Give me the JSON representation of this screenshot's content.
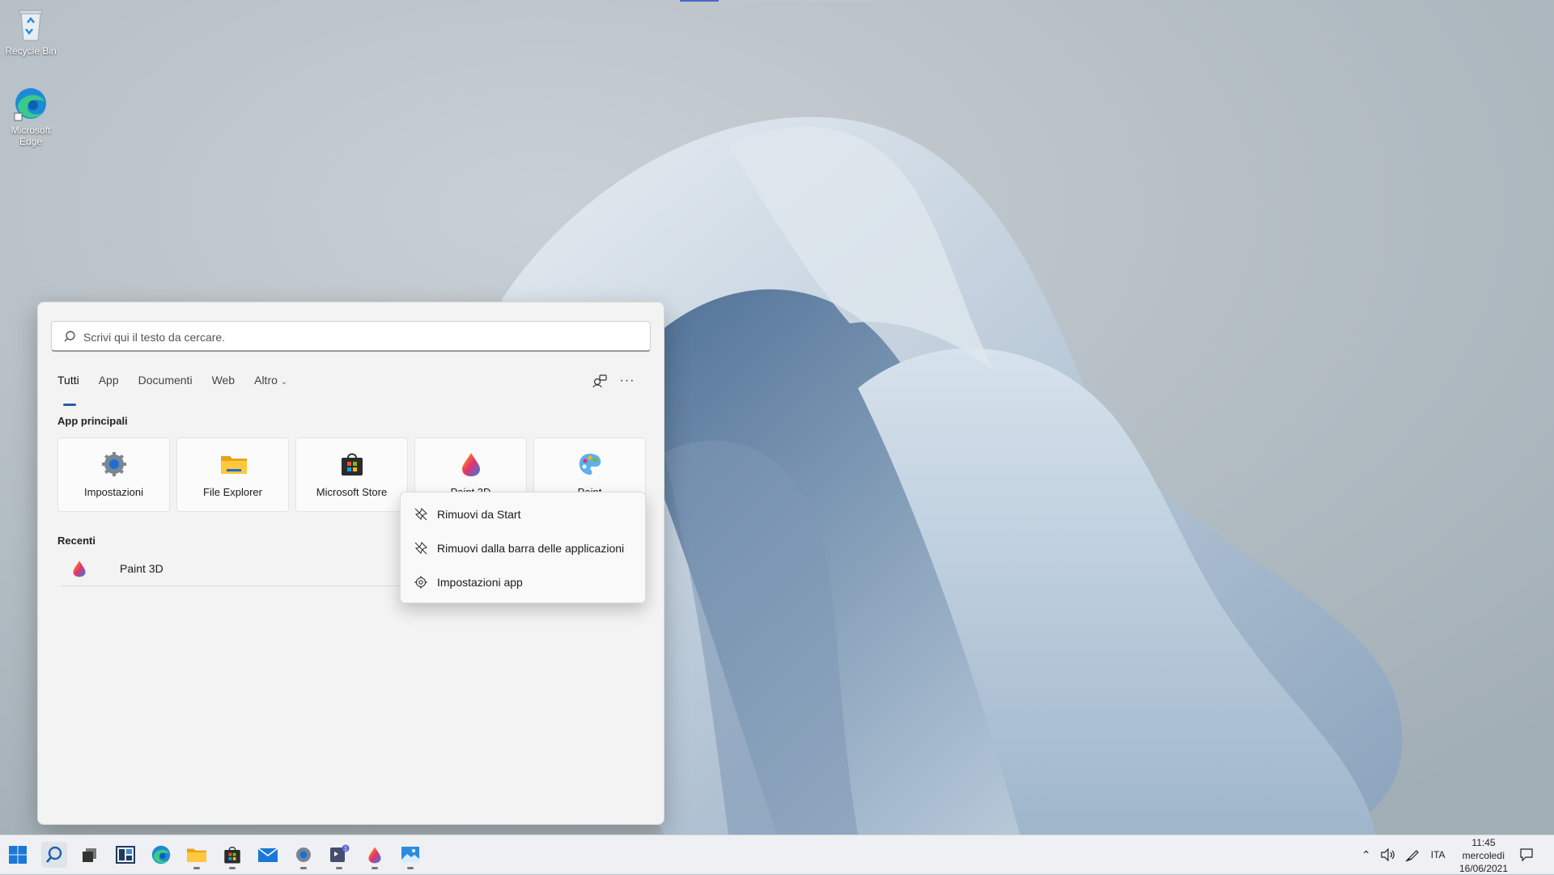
{
  "desktop": {
    "icons": [
      {
        "label": "Recycle Bin",
        "icon": "recycle-bin-icon"
      },
      {
        "label": "Microsoft Edge",
        "icon": "edge-icon"
      }
    ]
  },
  "search_panel": {
    "placeholder": "Scrivi qui il testo da cercare.",
    "tabs": [
      {
        "label": "Tutti",
        "active": true
      },
      {
        "label": "App"
      },
      {
        "label": "Documenti"
      },
      {
        "label": "Web"
      },
      {
        "label": "Altro",
        "has_dropdown": true
      }
    ],
    "top_apps_title": "App principali",
    "top_apps": [
      {
        "label": "Impostazioni",
        "icon": "settings-gear-icon"
      },
      {
        "label": "File Explorer",
        "icon": "folder-icon"
      },
      {
        "label": "Microsoft Store",
        "icon": "store-bag-icon"
      },
      {
        "label": "Paint 3D",
        "icon": "paint3d-drop-icon"
      },
      {
        "label": "Paint",
        "icon": "paint-palette-icon"
      }
    ],
    "recent_title": "Recenti",
    "recent": [
      {
        "label": "Paint 3D",
        "icon": "paint3d-drop-icon"
      }
    ]
  },
  "context_menu": {
    "items": [
      {
        "label": "Rimuovi da Start",
        "icon": "unpin-icon"
      },
      {
        "label": "Rimuovi dalla barra delle applicazioni",
        "icon": "unpin-icon"
      },
      {
        "label": "Impostazioni app",
        "icon": "gear-icon"
      }
    ]
  },
  "taskbar": {
    "apps": [
      "start-icon",
      "search-icon",
      "task-view-icon",
      "widgets-icon",
      "edge-icon",
      "file-explorer-icon",
      "store-icon",
      "mail-icon",
      "settings-icon",
      "teams-icon",
      "paint3d-icon",
      "photos-icon"
    ],
    "tray": {
      "language": "ITA",
      "time": "11:45",
      "day": "mercoledì",
      "date": "16/06/2021"
    }
  },
  "colors": {
    "accent": "#2a5ba8",
    "panel_bg": "#f3f3f3",
    "taskbar_bg": "#eef0f3"
  }
}
